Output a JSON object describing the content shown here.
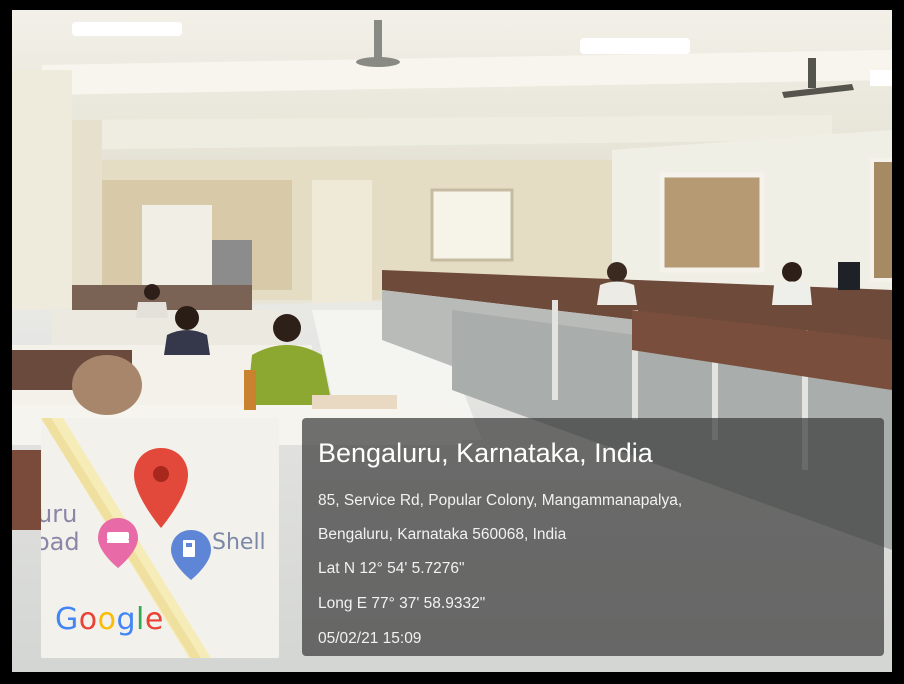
{
  "photo": {
    "subject": "open-plan-office-scene"
  },
  "map": {
    "road_label_line1": "uru",
    "road_label_line2": "oad",
    "shell_label": "Shell",
    "google_logo": {
      "letters": [
        "G",
        "o",
        "o",
        "g",
        "l",
        "e"
      ],
      "colors": [
        "#4285F4",
        "#EA4335",
        "#FBBC05",
        "#4285F4",
        "#34A853",
        "#EA4335"
      ]
    },
    "icons": [
      "location-pin-icon",
      "lodging-icon",
      "fuel-station-icon"
    ],
    "pin_color": "#E74C3C"
  },
  "info": {
    "title": "Bengaluru, Karnataka, India",
    "address_line1": "85, Service Rd, Popular Colony, Mangammanapalya,",
    "address_line2": "Bengaluru, Karnataka 560068, India",
    "latitude": "Lat N 12° 54' 5.7276\"",
    "longitude": "Long E 77° 37' 58.9332\"",
    "timestamp": "05/02/21 15:09"
  }
}
